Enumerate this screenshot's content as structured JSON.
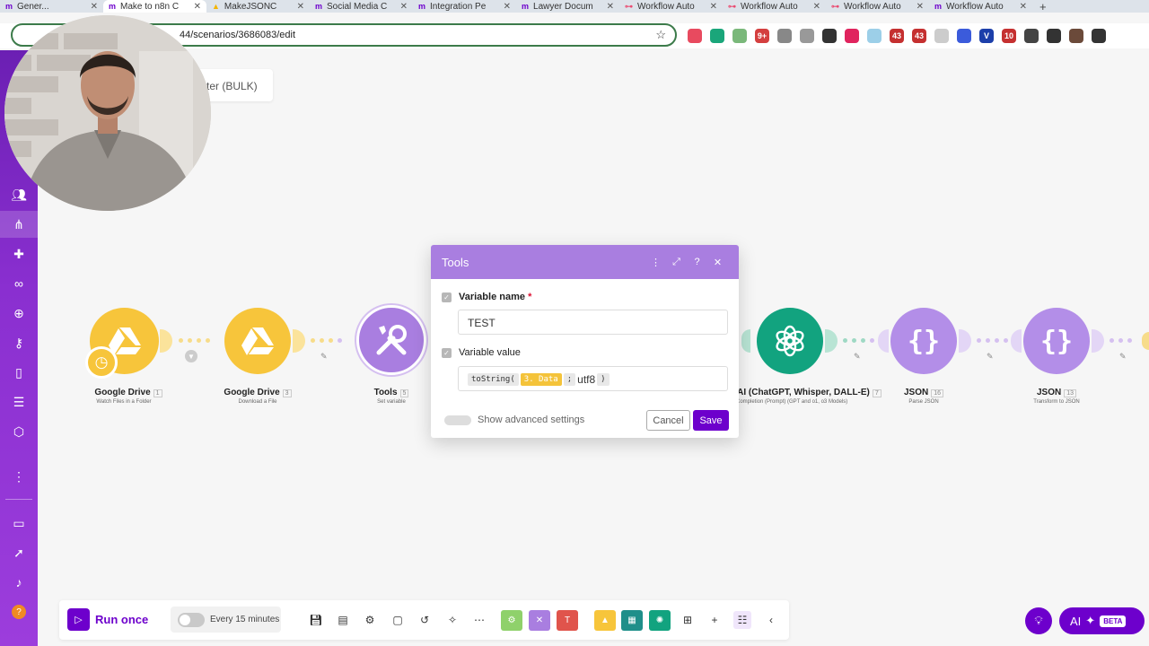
{
  "browser": {
    "tabs": [
      {
        "label": "Gener..."
      },
      {
        "label": "Make to n8n C"
      },
      {
        "label": "MakeJSONC"
      },
      {
        "label": "Social Media C"
      },
      {
        "label": "Integration Pe"
      },
      {
        "label": "Lawyer Docum"
      },
      {
        "label": "Workflow Auto"
      },
      {
        "label": "Workflow Auto"
      },
      {
        "label": "Workflow Auto"
      },
      {
        "label": "Workflow Auto"
      }
    ],
    "new_tab_symbol": "+",
    "url": "44/scenarios/3686083/edit",
    "extensions": [
      {
        "color": "#e84a5f",
        "text": ""
      },
      {
        "color": "#1aa67a",
        "text": ""
      },
      {
        "color": "#7ab87a",
        "text": ""
      },
      {
        "color": "#d43f3f",
        "text": "9+"
      },
      {
        "color": "#888888",
        "text": ""
      },
      {
        "color": "#999999",
        "text": ""
      },
      {
        "color": "#333333",
        "text": ""
      },
      {
        "color": "#e0245e",
        "text": ""
      },
      {
        "color": "#9ccfe8",
        "text": ""
      },
      {
        "color": "#c53030",
        "text": "43"
      },
      {
        "color": "#c53030",
        "text": "43"
      },
      {
        "color": "#cccccc",
        "text": ""
      },
      {
        "color": "#3b5bdb",
        "text": ""
      },
      {
        "color": "#1c3faa",
        "text": "V"
      },
      {
        "color": "#c53030",
        "text": "10"
      },
      {
        "color": "#444444",
        "text": ""
      },
      {
        "color": "#333333",
        "text": ""
      },
      {
        "color": "#6b4a3a",
        "text": ""
      },
      {
        "color": "#333333",
        "text": ""
      }
    ]
  },
  "scenario": {
    "name_partial": "ter (BULK)"
  },
  "modules": [
    {
      "title": "Google Drive",
      "num": "1",
      "sub": "Watch Files in a Folder",
      "color": "#f7c53b"
    },
    {
      "title": "Google Drive",
      "num": "3",
      "sub": "Download a File",
      "color": "#f7c53b"
    },
    {
      "title": "Tools",
      "num": "5",
      "sub": "Set variable",
      "color": "#a97ee0"
    },
    {
      "title": "nAI (ChatGPT, Whisper, DALL-E)",
      "num": "7",
      "sub": "a Completion (Prompt) (GPT and o1, o3 Models)",
      "color": "#12a37f"
    },
    {
      "title": "JSON",
      "num": "16",
      "sub": "Parse JSON",
      "color": "#b38ee8"
    },
    {
      "title": "JSON",
      "num": "13",
      "sub": "Transform to JSON",
      "color": "#b38ee8"
    }
  ],
  "dialog": {
    "title": "Tools",
    "var_name_label": "Variable name",
    "var_name_required": "*",
    "var_name_value": "TEST",
    "var_value_label": "Variable value",
    "expr": {
      "fn_open": "toString(",
      "mapped": "3. Data",
      "sep": ";",
      "arg": "utf8",
      "close": ")"
    },
    "advanced_label": "Show advanced settings",
    "cancel_label": "Cancel",
    "save_label": "Save"
  },
  "toolbar": {
    "run_label": "Run once",
    "schedule_label": "Every 15 minutes",
    "colored_tools": [
      {
        "color": "#8fd16b"
      },
      {
        "color": "#a97ee0"
      },
      {
        "color": "#e0544c"
      },
      {
        "color": "#f7c53b"
      },
      {
        "color": "#1f8f8a"
      },
      {
        "color": "#12a37f"
      }
    ]
  },
  "ai": {
    "label": "AI",
    "badge": "BETA"
  }
}
